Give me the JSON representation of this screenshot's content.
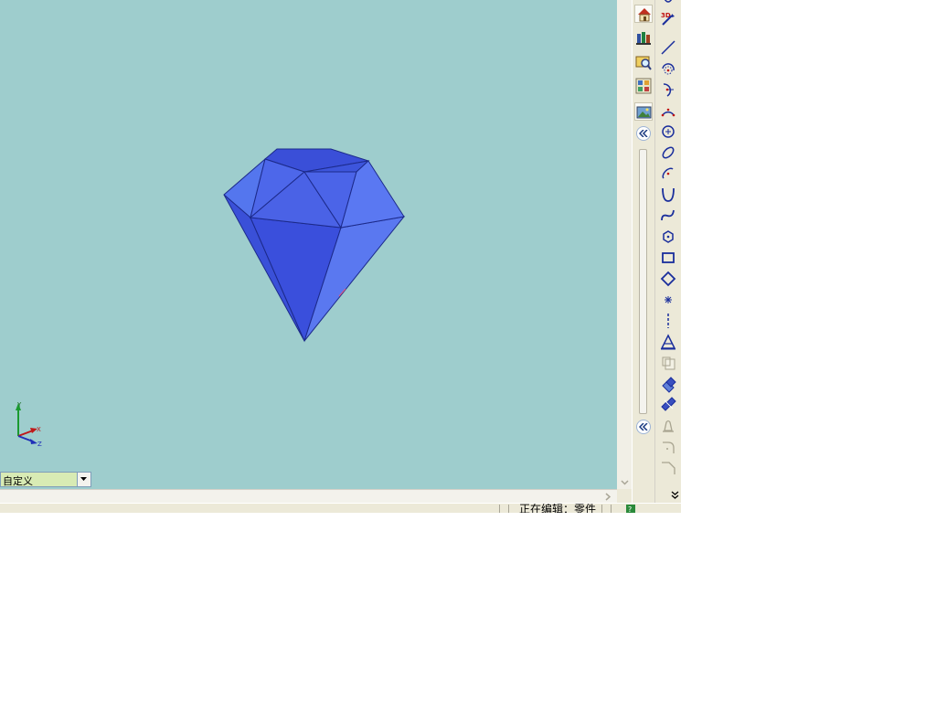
{
  "viewport": {
    "background": "#9ecdcd",
    "model": "diamond-gem",
    "model_color": "#3d58e8",
    "axes": {
      "x": "X",
      "y": "Y",
      "z": "Z"
    }
  },
  "view_select": {
    "value": "自定义"
  },
  "statusbar": {
    "text": "正在编辑：零件"
  },
  "panel1": {
    "items": [
      {
        "name": "home-icon"
      },
      {
        "name": "parts-library-icon"
      },
      {
        "name": "search-catalog-icon"
      },
      {
        "name": "design-tree-icon"
      },
      {
        "name": "image-view-icon"
      }
    ]
  },
  "panel2": {
    "items": [
      {
        "name": "sketch-3d-icon"
      },
      {
        "name": "line-icon"
      },
      {
        "name": "tangent-arc-icon"
      },
      {
        "name": "arc-icon"
      },
      {
        "name": "three-point-arc-icon"
      },
      {
        "name": "circle-icon"
      },
      {
        "name": "ellipse-icon"
      },
      {
        "name": "partial-ellipse-icon"
      },
      {
        "name": "parabola-icon"
      },
      {
        "name": "spline-icon"
      },
      {
        "name": "polygon-icon"
      },
      {
        "name": "rectangle-icon"
      },
      {
        "name": "parallelogram-icon"
      },
      {
        "name": "point-icon"
      },
      {
        "name": "centerline-icon"
      },
      {
        "name": "text-icon"
      },
      {
        "name": "convert-entities-icon"
      },
      {
        "name": "offset-entities-icon"
      },
      {
        "name": "mirror-entities-icon"
      },
      {
        "name": "fillet-icon"
      },
      {
        "name": "chamfer-icon"
      },
      {
        "name": "trim-icon"
      },
      {
        "name": "extend-icon"
      }
    ]
  },
  "colors": {
    "toolbar_bg": "#ece9d8",
    "icon_blue": "#1a2e9c",
    "icon_red": "#d01010",
    "disabled": "#a8a490"
  }
}
